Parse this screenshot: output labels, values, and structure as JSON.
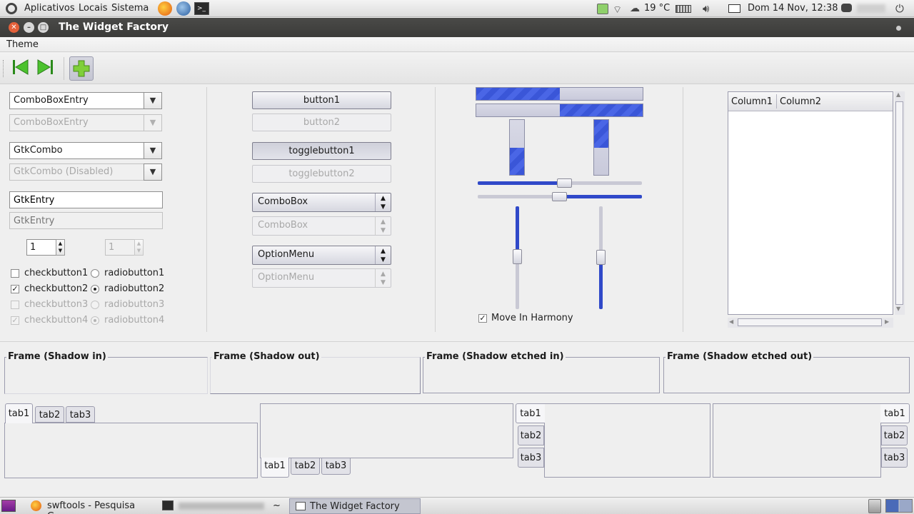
{
  "panel": {
    "menus": [
      "Aplicativos",
      "Locais",
      "Sistema"
    ],
    "weather": "19 °C",
    "datetime": "Dom 14 Nov, 12:38"
  },
  "window": {
    "title": "The Widget Factory"
  },
  "menubar": {
    "theme": "Theme"
  },
  "col1": {
    "combo_entry": "ComboBoxEntry",
    "combo_entry_dis": "ComboBoxEntry",
    "gtkcombo": "GtkCombo",
    "gtkcombo_dis": "GtkCombo (Disabled)",
    "entry": "GtkEntry",
    "entry_dis_placeholder": "GtkEntry",
    "spin1": "1",
    "spin2": "1",
    "checks": [
      "checkbutton1",
      "checkbutton2",
      "checkbutton3",
      "checkbutton4"
    ],
    "radios": [
      "radiobutton1",
      "radiobutton2",
      "radiobutton3",
      "radiobutton4"
    ]
  },
  "col2": {
    "button1": "button1",
    "button2": "button2",
    "toggle1": "togglebutton1",
    "toggle2": "togglebutton2",
    "combobox": "ComboBox",
    "combobox_dis": "ComboBox",
    "optionmenu": "OptionMenu",
    "optionmenu_dis": "OptionMenu"
  },
  "col3": {
    "move_in_harmony": "Move In Harmony",
    "progress_h1": 0.5,
    "progress_h2": 0.5,
    "progress_v1": 0.5,
    "progress_v2": 0.5
  },
  "treeview": {
    "columns": [
      "Column1",
      "Column2"
    ]
  },
  "frames": [
    "Frame (Shadow in)",
    "Frame (Shadow out)",
    "Frame (Shadow etched in)",
    "Frame (Shadow etched out)"
  ],
  "tabs": [
    "tab1",
    "tab2",
    "tab3"
  ],
  "taskbar": {
    "items": [
      "swftools - Pesquisa G...",
      "~",
      "The Widget Factory"
    ]
  },
  "colors": {
    "accent": "#3a56d8",
    "titlebar": "#3c3b37"
  }
}
